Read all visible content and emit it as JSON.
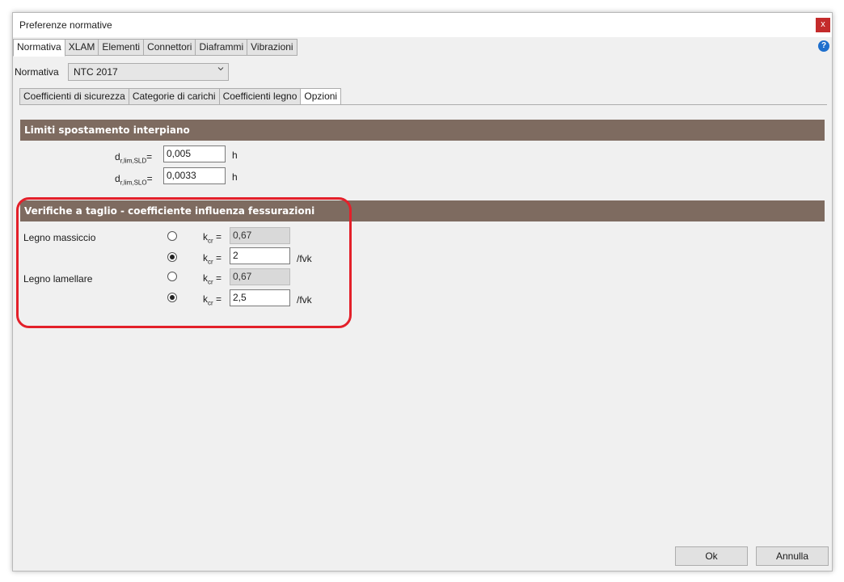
{
  "window": {
    "title": "Preferenze normative",
    "close_label": "x"
  },
  "main_tabs": [
    "Normativa",
    "XLAM",
    "Elementi",
    "Connettori",
    "Diaframmi",
    "Vibrazioni"
  ],
  "help_label": "?",
  "normativa": {
    "label": "Normativa",
    "selected": "NTC 2017"
  },
  "sub_tabs": [
    "Coefficienti di sicurezza",
    "Categorie di carichi",
    "Coefficienti legno",
    "Opzioni"
  ],
  "limiti": {
    "header": "Limiti spostamento interpiano",
    "rows": [
      {
        "label_main": "d",
        "label_sub": "r,lim,SLD",
        "label_tail": "=",
        "value": "0,005",
        "unit": "h"
      },
      {
        "label_main": "d",
        "label_sub": "r,lim,SLO",
        "label_tail": "=",
        "value": "0,0033",
        "unit": "h"
      }
    ]
  },
  "verifiche": {
    "header": "Verifiche a taglio - coefficiente influenza fessurazioni",
    "kcr_main": "k",
    "kcr_sub": "cr",
    "kcr_tail": " =",
    "groups": [
      {
        "label": "Legno massiccio",
        "options": [
          {
            "value": "0,67",
            "unit": ""
          },
          {
            "value": "2",
            "unit": "/fvk"
          }
        ]
      },
      {
        "label": "Legno lamellare",
        "options": [
          {
            "value": "0,67",
            "unit": ""
          },
          {
            "value": "2,5",
            "unit": "/fvk"
          }
        ]
      }
    ]
  },
  "buttons": {
    "ok": "Ok",
    "cancel": "Annulla"
  },
  "colors": {
    "section_header": "#7e6b60",
    "highlight": "#e3202a",
    "close": "#c42b2b",
    "help": "#1e6fcd"
  }
}
